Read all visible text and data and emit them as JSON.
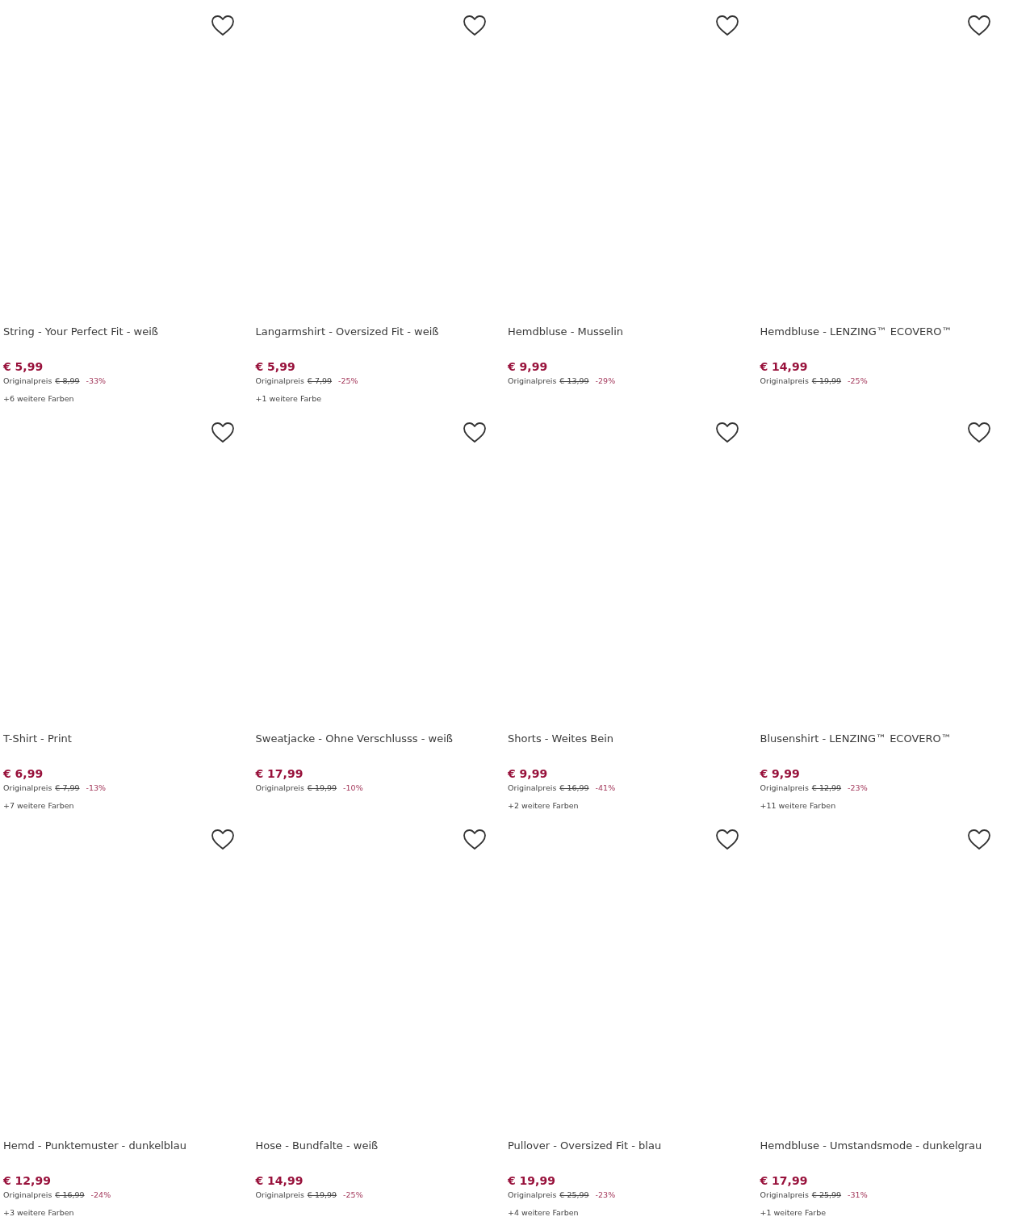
{
  "products": [
    {
      "title": "String - Your Perfect Fit - weiß",
      "price": "€ 5,99",
      "original_label": "Originalpreis",
      "original_price": "€ 8,99",
      "discount": "-33%",
      "more_colors": "+6 weitere Farben",
      "wishlisted": false
    },
    {
      "title": "Langarmshirt - Oversized Fit - weiß",
      "price": "€ 5,99",
      "original_label": "Originalpreis",
      "original_price": "€ 7,99",
      "discount": "-25%",
      "more_colors": "+1 weitere Farbe",
      "wishlisted": false
    },
    {
      "title": "Hemdbluse - Musselin",
      "price": "€ 9,99",
      "original_label": "Originalpreis",
      "original_price": "€ 13,99",
      "discount": "-29%",
      "wishlisted": false
    },
    {
      "title": "Hemdbluse - LENZING™ ECOVERO™",
      "price": "€ 14,99",
      "original_label": "Originalpreis",
      "original_price": "€ 19,99",
      "discount": "-25%",
      "wishlisted": false
    },
    {
      "title": "T-Shirt - Print",
      "price": "€ 6,99",
      "original_label": "Originalpreis",
      "original_price": "€ 7,99",
      "discount": "-13%",
      "more_colors": "+7 weitere Farben",
      "wishlisted": false
    },
    {
      "title": "Sweatjacke - Ohne Verschlusss - weiß",
      "price": "€ 17,99",
      "original_label": "Originalpreis",
      "original_price": "€ 19,99",
      "discount": "-10%",
      "wishlisted": false
    },
    {
      "title": "Shorts - Weites Bein",
      "price": "€ 9,99",
      "original_label": "Originalpreis",
      "original_price": "€ 16,99",
      "discount": "-41%",
      "more_colors": "+2 weitere Farben",
      "wishlisted": false
    },
    {
      "title": "Blusenshirt - LENZING™ ECOVERO™",
      "price": "€ 9,99",
      "original_label": "Originalpreis",
      "original_price": "€ 12,99",
      "discount": "-23%",
      "more_colors": "+11 weitere Farben",
      "wishlisted": false
    },
    {
      "title": "Hemd - Punktemuster - dunkelblau",
      "price": "€ 12,99",
      "original_label": "Originalpreis",
      "original_price": "€ 16,99",
      "discount": "-24%",
      "more_colors": "+3 weitere Farben",
      "wishlisted": false
    },
    {
      "title": "Hose - Bundfalte - weiß",
      "price": "€ 14,99",
      "original_label": "Originalpreis",
      "original_price": "€ 19,99",
      "discount": "-25%",
      "wishlisted": false
    },
    {
      "title": "Pullover - Oversized Fit - blau",
      "price": "€ 19,99",
      "original_label": "Originalpreis",
      "original_price": "€ 25,99",
      "discount": "-23%",
      "more_colors": "+4 weitere Farben",
      "wishlisted": false
    },
    {
      "title": "Hemdbluse - Umstandsmode - dunkelgrau",
      "price": "€ 17,99",
      "original_label": "Originalpreis",
      "original_price": "€ 25,99",
      "discount": "-31%",
      "more_colors": "+1 weitere Farbe",
      "wishlisted": false
    }
  ]
}
